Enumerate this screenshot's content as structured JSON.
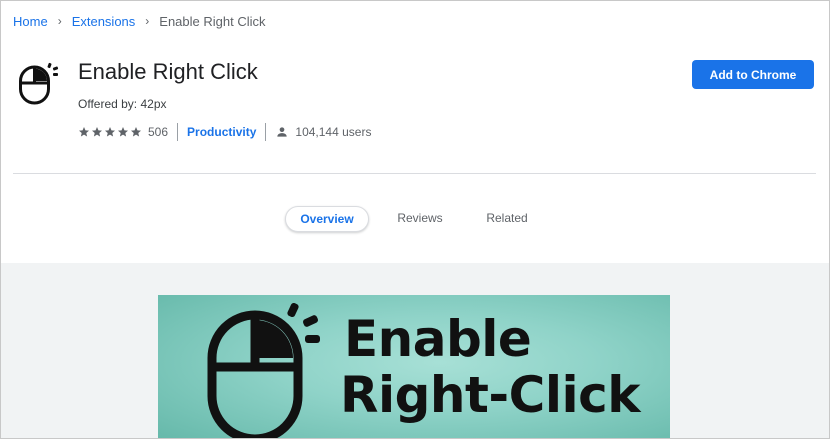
{
  "breadcrumb": {
    "home": "Home",
    "extensions": "Extensions",
    "current": "Enable Right Click"
  },
  "extension": {
    "title": "Enable Right Click",
    "offered_by": "Offered by: 42px",
    "rating_stars": 5,
    "rating_count": "506",
    "category": "Productivity",
    "users": "104,144 users",
    "icon": "mouse-icon"
  },
  "actions": {
    "add_label": "Add to Chrome"
  },
  "tabs": [
    {
      "label": "Overview",
      "active": true
    },
    {
      "label": "Reviews",
      "active": false
    },
    {
      "label": "Related",
      "active": false
    }
  ],
  "banner": {
    "line1": "Enable",
    "line2": "Right-Click"
  },
  "colors": {
    "accent": "#1a73e8",
    "banner_bg": "#8fd3c8"
  }
}
